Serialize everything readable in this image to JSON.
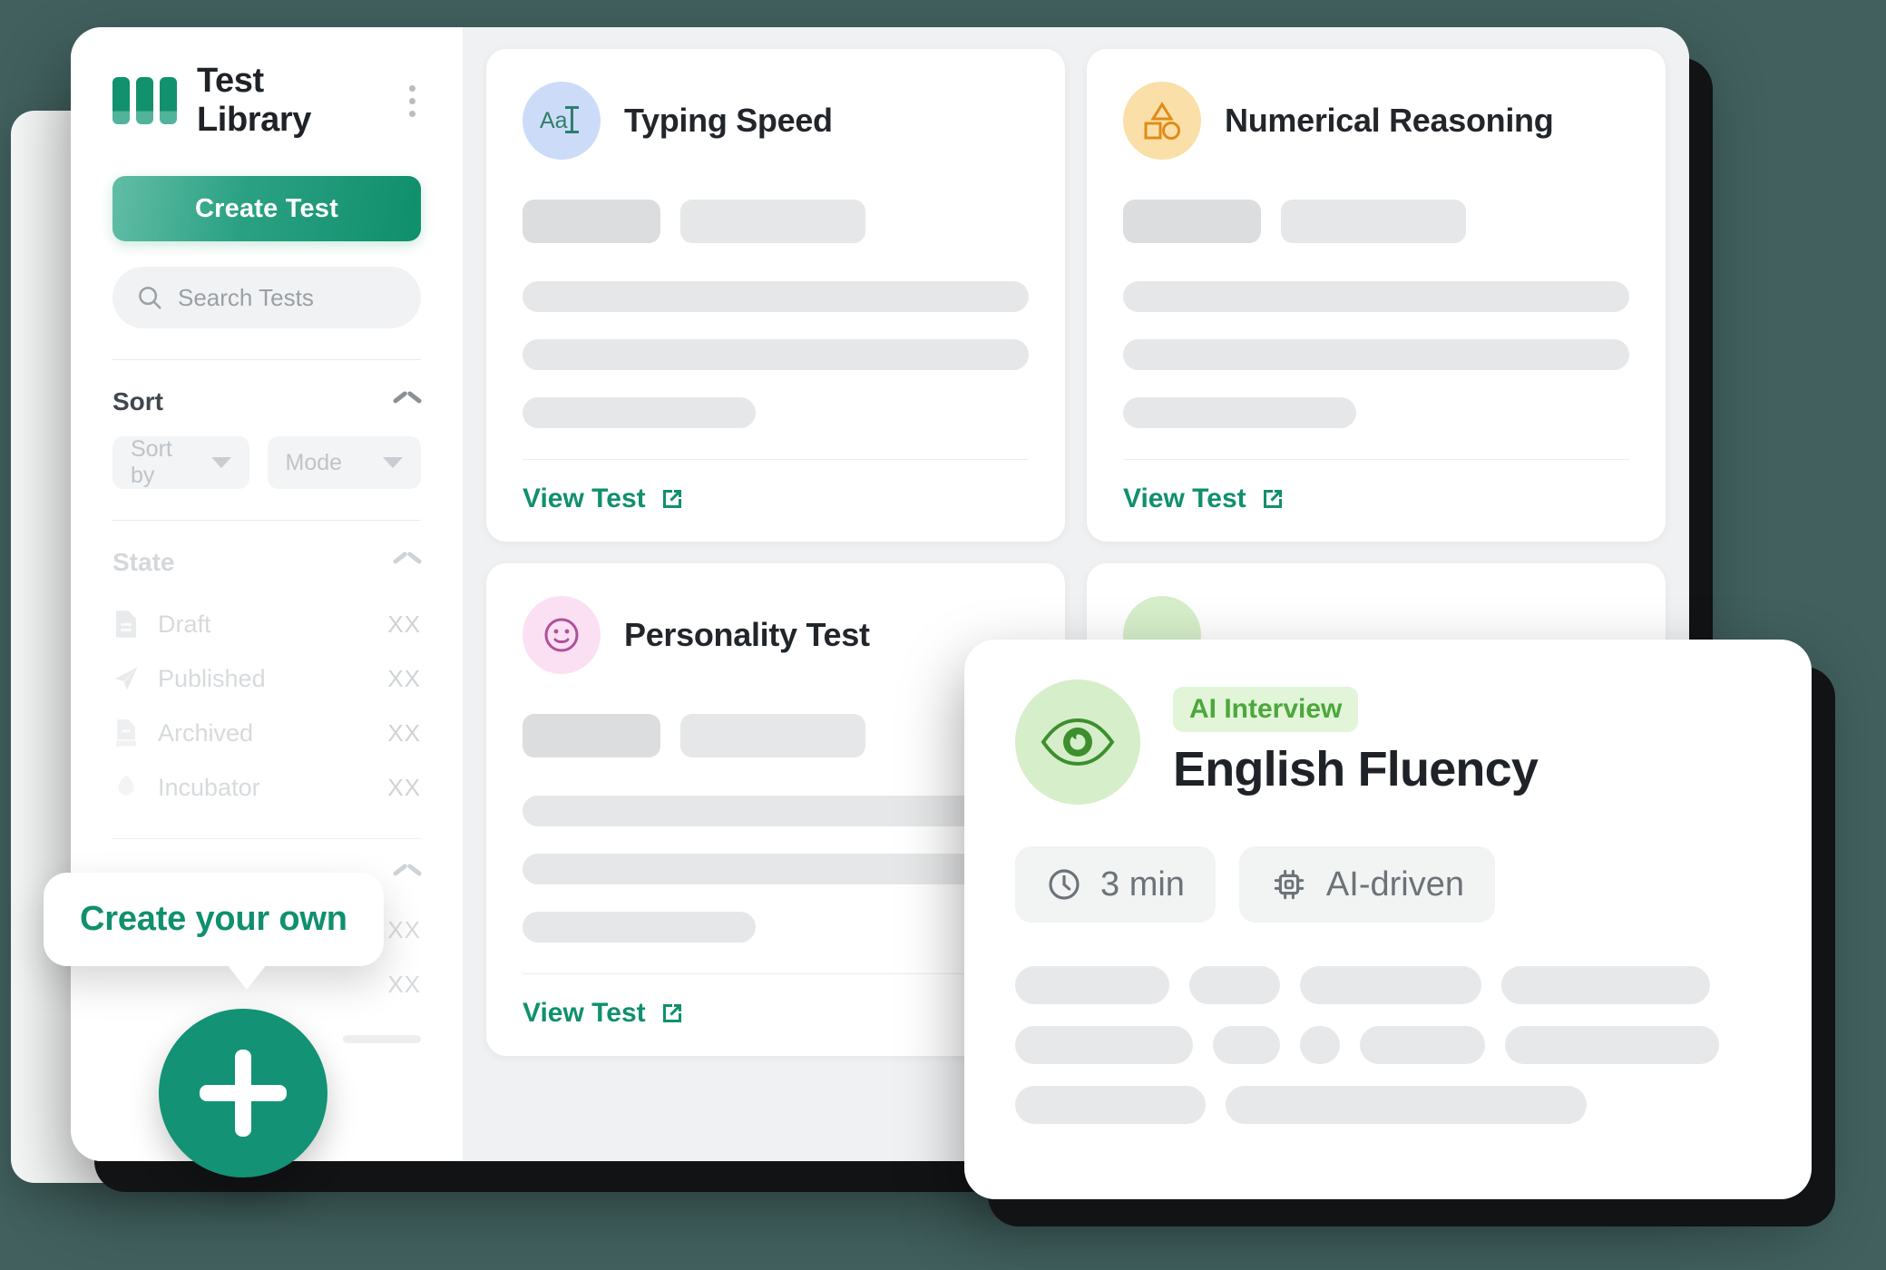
{
  "theme": {
    "background": "#41605e",
    "brand_teal": "#12916e",
    "accent_green": "#4ba83a",
    "card_bg": "#ffffff",
    "content_bg": "#f0f1f2",
    "skeleton": "#e6e7e8"
  },
  "sidebar": {
    "title": "Test Library",
    "logo_icon": "library-bars-icon",
    "menu_icon": "kebab-menu-icon",
    "create_button": "Create Test",
    "search": {
      "icon": "search-icon",
      "placeholder": "Search Tests",
      "value": ""
    },
    "sections": [
      {
        "label": "Sort",
        "chevron": "chevron-up-icon",
        "selects": [
          {
            "label": "Sort by",
            "caret": "caret-down-icon"
          },
          {
            "label": "Mode",
            "caret": "caret-down-icon"
          }
        ]
      },
      {
        "label": "State",
        "chevron": "chevron-up-icon",
        "items": [
          {
            "icon": "document-icon",
            "label": "Draft",
            "count": "XX"
          },
          {
            "icon": "paper-plane-icon",
            "label": "Published",
            "count": "XX"
          },
          {
            "icon": "archive-icon",
            "label": "Archived",
            "count": "XX"
          },
          {
            "icon": "incubator-icon",
            "label": "Incubator",
            "count": "XX"
          }
        ]
      },
      {
        "label": "",
        "chevron": "chevron-up-icon",
        "tail_counts": [
          "XX",
          "XX"
        ]
      }
    ]
  },
  "cards": [
    {
      "title": "Typing Speed",
      "icon": "typing-aa-cursor-icon",
      "icon_bg": "#ccdcf8",
      "icon_color": "#2f7f6b",
      "view_label": "View Test",
      "view_icon": "external-link-icon"
    },
    {
      "title": "Numerical Reasoning",
      "icon": "shapes-triangle-square-circle-icon",
      "icon_bg": "#fbdfa8",
      "icon_color": "#df8c16",
      "view_label": "View Test",
      "view_icon": "external-link-icon"
    },
    {
      "title": "Personality Test",
      "icon": "smiley-face-icon",
      "icon_bg": "#fbe0f3",
      "icon_color": "#b0509a",
      "view_label": "View Test",
      "view_icon": "external-link-icon"
    },
    {
      "title": "",
      "icon": "test-icon",
      "icon_bg": "#d6eeca",
      "icon_color": "#3d8f2e",
      "view_label": "",
      "view_icon": "external-link-icon"
    }
  ],
  "tooltip": {
    "text": "Create your own",
    "fab_icon": "plus-icon"
  },
  "feature_card": {
    "icon": "eye-icon",
    "badge": "AI Interview",
    "title": "English Fluency",
    "chips": [
      {
        "icon": "clock-icon",
        "label": "3 min"
      },
      {
        "icon": "chip-cpu-icon",
        "label": "AI-driven"
      }
    ]
  }
}
